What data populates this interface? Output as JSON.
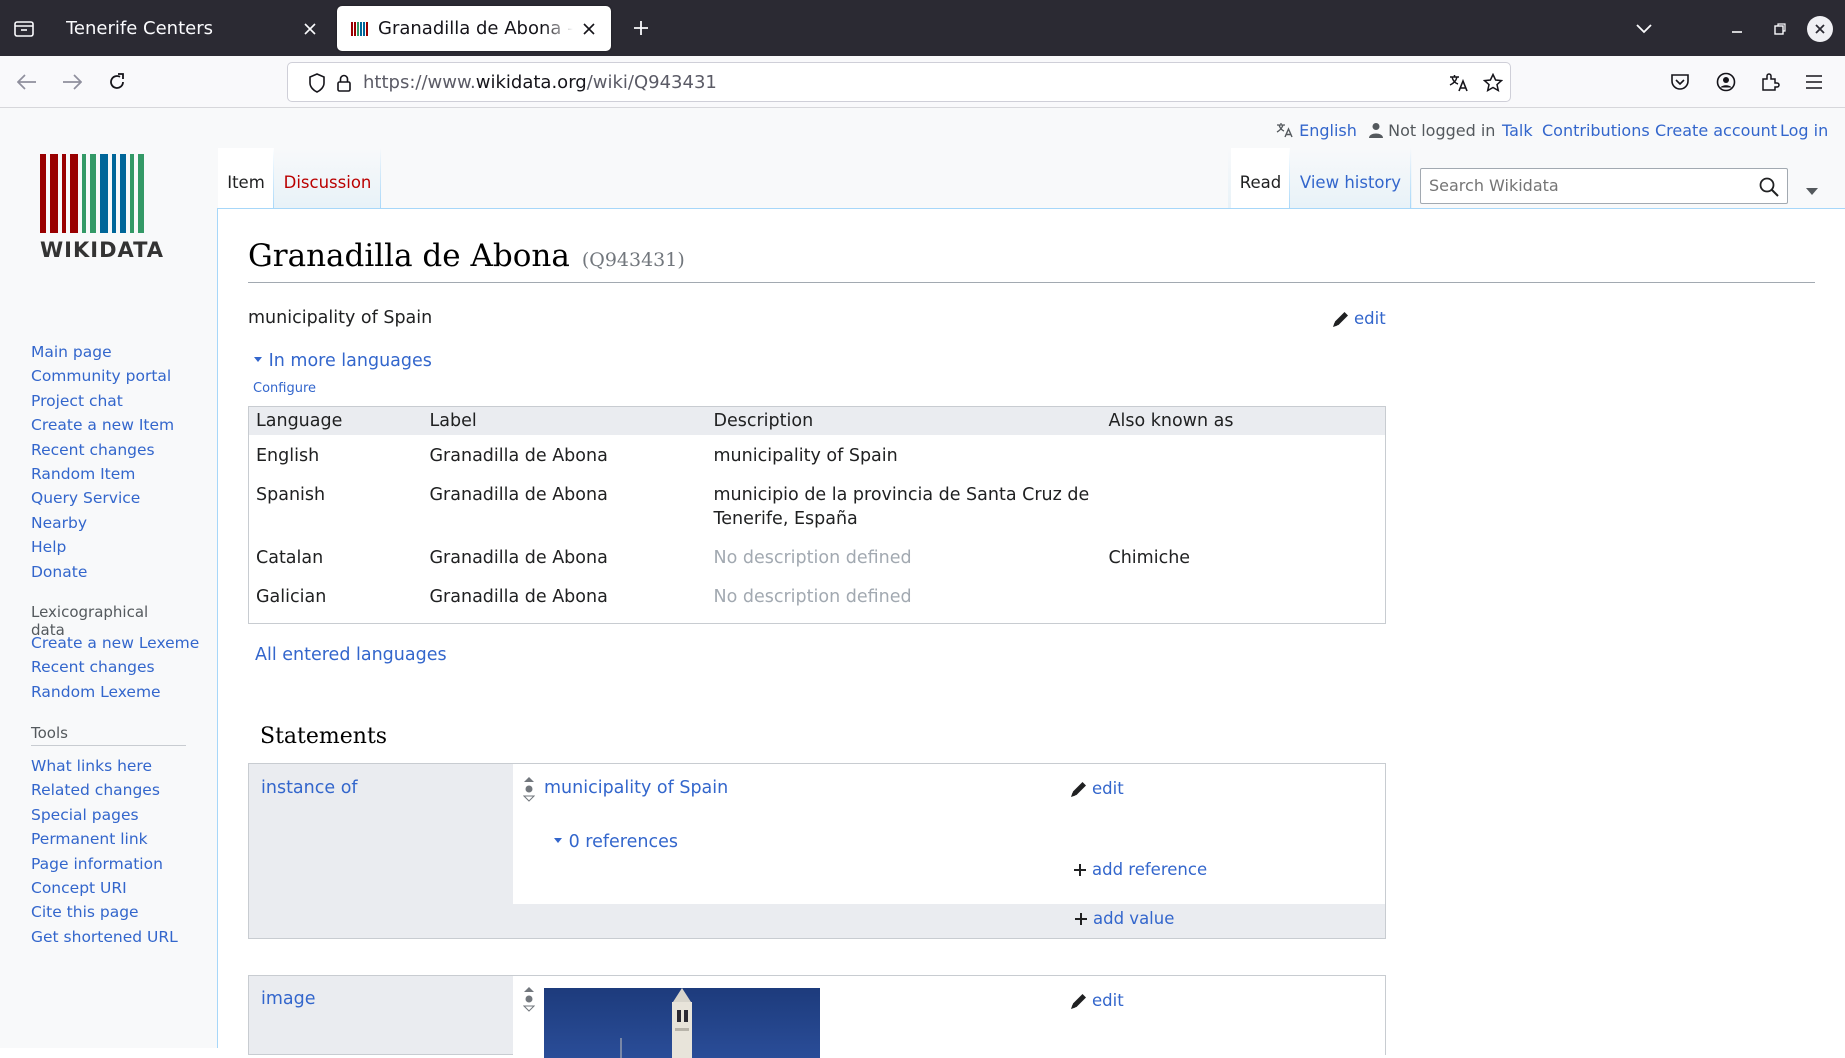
{
  "browser": {
    "tabs": [
      {
        "title": "Tenerife Centers",
        "active": false
      },
      {
        "title": "Granadilla de Abona - Wikidata",
        "active": true
      }
    ],
    "url_prefix": "https://www.",
    "url_domain": "wikidata.org",
    "url_path": "/wiki/Q943431"
  },
  "personal": {
    "language": "English",
    "not_logged_in": "Not logged in",
    "talk": "Talk",
    "contributions": "Contributions",
    "create_account": "Create account",
    "log_in": "Log in"
  },
  "logo": {
    "wordmark": "WIKIDATA",
    "bar_colors": [
      "#990000",
      "#339966",
      "#006699"
    ]
  },
  "tabs": {
    "item": "Item",
    "discussion": "Discussion",
    "read": "Read",
    "history": "View history"
  },
  "search": {
    "placeholder": "Search Wikidata"
  },
  "sidebar": {
    "nav": [
      "Main page",
      "Community portal",
      "Project chat",
      "Create a new Item",
      "Recent changes",
      "Random Item",
      "Query Service",
      "Nearby",
      "Help",
      "Donate"
    ],
    "lexico_heading": "Lexicographical data",
    "lexico": [
      "Create a new Lexeme",
      "Recent changes",
      "Random Lexeme"
    ],
    "tools_heading": "Tools",
    "tools": [
      "What links here",
      "Related changes",
      "Special pages",
      "Permanent link",
      "Page information",
      "Concept URI",
      "Cite this page",
      "Get shortened URL"
    ]
  },
  "item": {
    "label": "Granadilla de Abona",
    "qid": "(Q943431)",
    "description": "municipality of Spain",
    "edit": "edit",
    "in_more_languages": "In more languages",
    "configure": "Configure",
    "table_headers": [
      "Language",
      "Label",
      "Description",
      "Also known as"
    ],
    "terms": [
      {
        "language": "English",
        "label": "Granadilla de Abona",
        "description": "municipality of Spain",
        "aliases": ""
      },
      {
        "language": "Spanish",
        "label": "Granadilla de Abona",
        "description": "municipio de la provincia de Santa Cruz de Tenerife, España",
        "aliases": ""
      },
      {
        "language": "Catalan",
        "label": "Granadilla de Abona",
        "description": "No description defined",
        "aliases": "Chimiche"
      },
      {
        "language": "Galician",
        "label": "Granadilla de Abona",
        "description": "No description defined",
        "aliases": ""
      }
    ],
    "all_languages": "All entered languages"
  },
  "statements": {
    "heading": "Statements",
    "list": [
      {
        "property": "instance of",
        "value": "municipality of Spain",
        "references": "0 references",
        "add_reference": "add reference",
        "add_value": "add value",
        "edit": "edit"
      },
      {
        "property": "image",
        "edit": "edit"
      }
    ]
  },
  "colors": {
    "link": "#3366cc",
    "red_link": "#ba0000",
    "chrome": "#2b2a33"
  }
}
